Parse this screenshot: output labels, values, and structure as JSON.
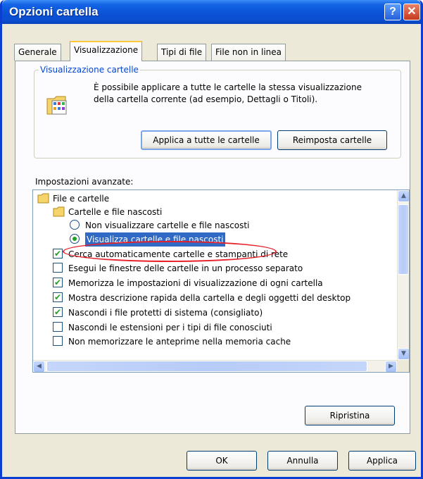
{
  "window": {
    "title": "Opzioni cartella"
  },
  "titlebar": {
    "help_glyph": "?",
    "close_glyph": "✕"
  },
  "tabs": [
    {
      "label": "Generale"
    },
    {
      "label": "Visualizzazione",
      "active": true
    },
    {
      "label": "Tipi di file"
    },
    {
      "label": "File non in linea"
    }
  ],
  "folder_views": {
    "legend": "Visualizzazione cartelle",
    "description_line1": "È possibile applicare a tutte le cartelle la stessa visualizzazione",
    "description_line2": "della cartella corrente (ad esempio, Dettagli o Titoli).",
    "apply_all_label": "Applica a tutte le cartelle",
    "reset_label": "Reimposta cartelle"
  },
  "advanced": {
    "label": "Impostazioni avanzate:",
    "items": [
      {
        "text": "File e cartelle",
        "kind": "folder"
      },
      {
        "text": "Cartelle e file nascosti",
        "kind": "folder"
      },
      {
        "text": "Non visualizzare cartelle e file nascosti",
        "kind": "radio",
        "selected": false
      },
      {
        "text": "Visualizza cartelle e file nascosti",
        "kind": "radio",
        "selected": true
      },
      {
        "text": "Cerca automaticamente cartelle e stampanti di rete",
        "kind": "checkbox",
        "checked": true
      },
      {
        "text": "Esegui le finestre delle cartelle in un processo separato",
        "kind": "checkbox",
        "checked": false
      },
      {
        "text": "Memorizza le impostazioni di visualizzazione di ogni cartella",
        "kind": "checkbox",
        "checked": true
      },
      {
        "text": "Mostra descrizione rapida della cartella e degli oggetti del desktop",
        "kind": "checkbox",
        "checked": true
      },
      {
        "text": "Nascondi i file protetti di sistema (consigliato)",
        "kind": "checkbox",
        "checked": true
      },
      {
        "text": "Nascondi le estensioni per i tipi di file conosciuti",
        "kind": "checkbox",
        "checked": false
      },
      {
        "text": "Non memorizzare le anteprime nella memoria cache",
        "kind": "checkbox",
        "checked": false
      }
    ],
    "check_glyph": "✔",
    "restore_label": "Ripristina"
  },
  "footer": {
    "ok_label": "OK",
    "cancel_label": "Annulla",
    "apply_label": "Applica"
  },
  "colors": {
    "titlebar": "#0a52d6",
    "selection": "#316ac5",
    "annotation_circle": "#e8202a",
    "check": "#21a121"
  }
}
